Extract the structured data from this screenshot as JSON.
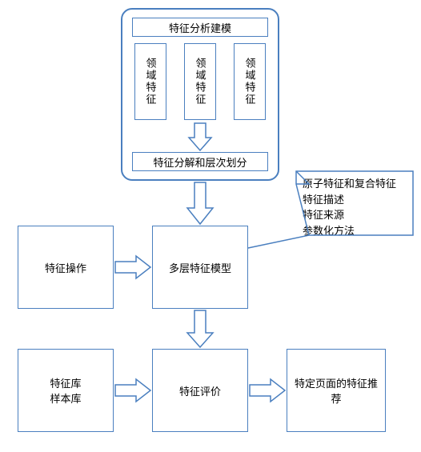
{
  "top_group": {
    "header": "特征分析建模",
    "col1": "领域特征",
    "col2": "领域特征",
    "col3": "领域特征",
    "decomp": "特征分解和层次划分"
  },
  "left_mid": "特征操作",
  "center_mid": "多层特征模型",
  "left_bot": "特征库\n样本库",
  "center_bot": "特征评价",
  "right_bot": "特定页面的特征推荐",
  "callout": {
    "l1": "原子特征和复合特征",
    "l2": "特征描述",
    "l3": "特征来源",
    "l4": "参数化方法"
  }
}
